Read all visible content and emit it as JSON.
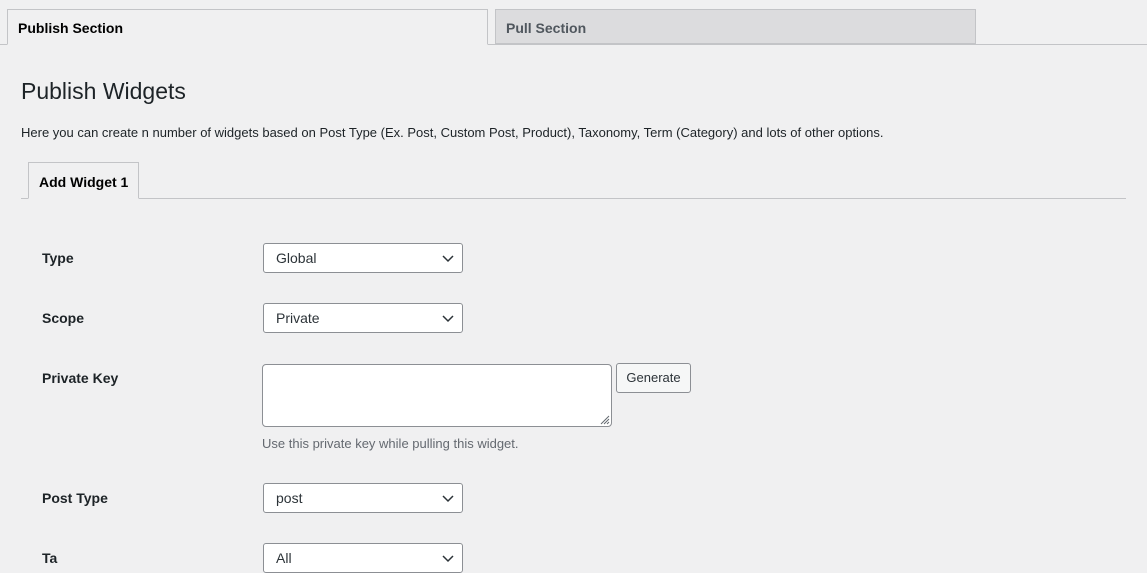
{
  "tabs": {
    "publish": "Publish Section",
    "pull": "Pull Section"
  },
  "page": {
    "title": "Publish Widgets",
    "description": "Here you can create n number of widgets based on Post Type (Ex. Post, Custom Post, Product), Taxonomy, Term (Category) and lots of other options."
  },
  "sub_tabs": {
    "add_widget": "Add Widget 1"
  },
  "form": {
    "type_label": "Type",
    "type_value": "Global",
    "scope_label": "Scope",
    "scope_value": "Private",
    "private_key_label": "Private Key",
    "private_key_value": "",
    "generate_label": "Generate",
    "private_key_help": "Use this private key while pulling this widget.",
    "post_type_label": "Post Type",
    "post_type_value": "post",
    "next_label": "Ta",
    "next_value": "All"
  },
  "icons": {
    "dropdown": "chevron-down-icon",
    "resize": "resize-grip-icon"
  }
}
